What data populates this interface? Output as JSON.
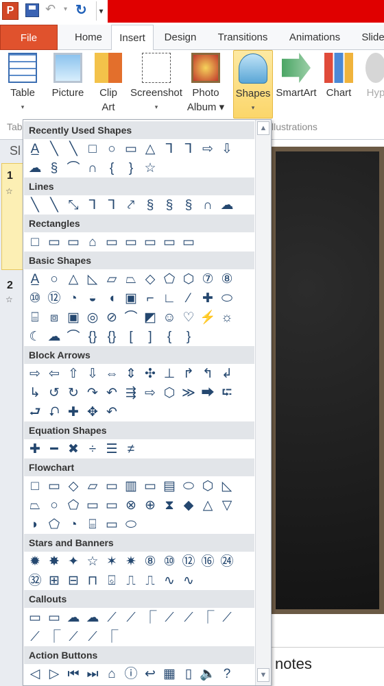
{
  "quick_access": {
    "app_icon_letter": "P",
    "save_icon": "save-icon",
    "undo_glyph": "↶",
    "undo_drop_glyph": "▾",
    "redo_glyph": "↻",
    "customize_glyph": "▾"
  },
  "tabs": [
    {
      "label": "File"
    },
    {
      "label": "Home"
    },
    {
      "label": "Insert"
    },
    {
      "label": "Design"
    },
    {
      "label": "Transitions"
    },
    {
      "label": "Animations"
    },
    {
      "label": "Slide"
    }
  ],
  "ribbon": {
    "table": {
      "line1": "Table",
      "caret": "▾"
    },
    "picture": {
      "line1": "Picture"
    },
    "clip_art": {
      "line1": "Clip",
      "line2": "Art"
    },
    "screenshot": {
      "line1": "Screenshot",
      "caret": "▾"
    },
    "photo_album": {
      "line1": "Photo",
      "line2": "Album ▾"
    },
    "shapes": {
      "line1": "Shapes",
      "caret": "▾"
    },
    "smartart": {
      "line1": "SmartArt"
    },
    "chart": {
      "line1": "Chart"
    },
    "hyperlink": {
      "line1": "Hyp"
    },
    "groups": {
      "tables": "Tab",
      "illustrations": "llustrations"
    }
  },
  "slides_panel": {
    "header": "Sl",
    "slides": [
      {
        "number": "1",
        "icon": "☆"
      },
      {
        "number": "2",
        "icon": "☆"
      }
    ]
  },
  "notes": {
    "text": "notes"
  },
  "shapes_menu": {
    "sections": [
      {
        "title": "Recently Used Shapes",
        "shapes": [
          "A̲",
          "╲",
          "╲",
          "□",
          "○",
          "▭",
          "△",
          "⅂",
          "⅂",
          "⇨",
          "⇩",
          "☁",
          "§",
          "⌒",
          "∩",
          "{",
          "}",
          "☆"
        ]
      },
      {
        "title": "Lines",
        "shapes": [
          "╲",
          "╲",
          "⤡",
          "⅂",
          "⅂",
          "⤤",
          "§",
          "§",
          "§",
          "∩",
          "☁",
          "§"
        ]
      },
      {
        "title": "Rectangles",
        "shapes": [
          "□",
          "▭",
          "▭",
          "⌂",
          "▭",
          "▭",
          "▭",
          "▭",
          "▭"
        ]
      },
      {
        "title": "Basic Shapes",
        "shapes": [
          "A̲",
          "○",
          "△",
          "◺",
          "▱",
          "⏢",
          "◇",
          "⬠",
          "⬡",
          "⑦",
          "⑧",
          "⑩",
          "⑫",
          "◔",
          "◒",
          "◖",
          "▣",
          "⌐",
          "∟",
          "⁄",
          "✚",
          "⬭",
          "⌸",
          "⧈",
          "▣",
          "◎",
          "⊘",
          "⌒",
          "◩",
          "☺",
          "♡",
          "⚡",
          "☼",
          "☾",
          "☁",
          "⌒",
          "{}",
          "{}",
          "[",
          "]",
          "{",
          "}"
        ]
      },
      {
        "title": "Block Arrows",
        "shapes": [
          "⇨",
          "⇦",
          "⇧",
          "⇩",
          "⇔",
          "⇕",
          "✣",
          "⊥",
          "↱",
          "↰",
          "↲",
          "↳",
          "↺",
          "↻",
          "↷",
          "↶",
          "⇶",
          "⇨",
          "⬡",
          "≫",
          "⮕",
          "⮓",
          "⮐",
          "⮏",
          "✚",
          "✥",
          "↶"
        ]
      },
      {
        "title": "Equation Shapes",
        "shapes": [
          "✚",
          "━",
          "✖",
          "÷",
          "☰",
          "≠"
        ]
      },
      {
        "title": "Flowchart",
        "shapes": [
          "□",
          "▭",
          "◇",
          "▱",
          "▭",
          "▥",
          "▭",
          "▤",
          "⬭",
          "⬡",
          "◺",
          "⏢",
          "○",
          "⬠",
          "▭",
          "▭",
          "⊗",
          "⊕",
          "⧗",
          "◆",
          "△",
          "▽",
          "◗",
          "⬠",
          "◔",
          "⌸",
          "▭",
          "⬭"
        ]
      },
      {
        "title": "Stars and Banners",
        "shapes": [
          "✹",
          "✸",
          "✦",
          "☆",
          "✶",
          "✷",
          "⑧",
          "⑩",
          "⑫",
          "⑯",
          "㉔",
          "㉜",
          "⊞",
          "⊟",
          "⊓",
          "⌺",
          "⎍",
          "⎍",
          "∿",
          "∿"
        ]
      },
      {
        "title": "Callouts",
        "shapes": [
          "▭",
          "▭",
          "☁",
          "☁",
          "⟋",
          "⟋",
          "⎾",
          "⟋",
          "⟋",
          "⎾",
          "⟋",
          "⟋",
          "⎾",
          "⟋",
          "⟋",
          "⎾"
        ]
      },
      {
        "title": "Action Buttons",
        "shapes": [
          "◁",
          "▷",
          "⏮",
          "⏭",
          "⌂",
          "ⓘ",
          "↩",
          "▦",
          "▯",
          "🔈",
          "?",
          "□"
        ]
      }
    ]
  },
  "colors": {
    "accent_red": "#e00000",
    "file_tab": "#e0522d",
    "shape_outline": "#24476f",
    "section_header": "#e2e5e9"
  }
}
